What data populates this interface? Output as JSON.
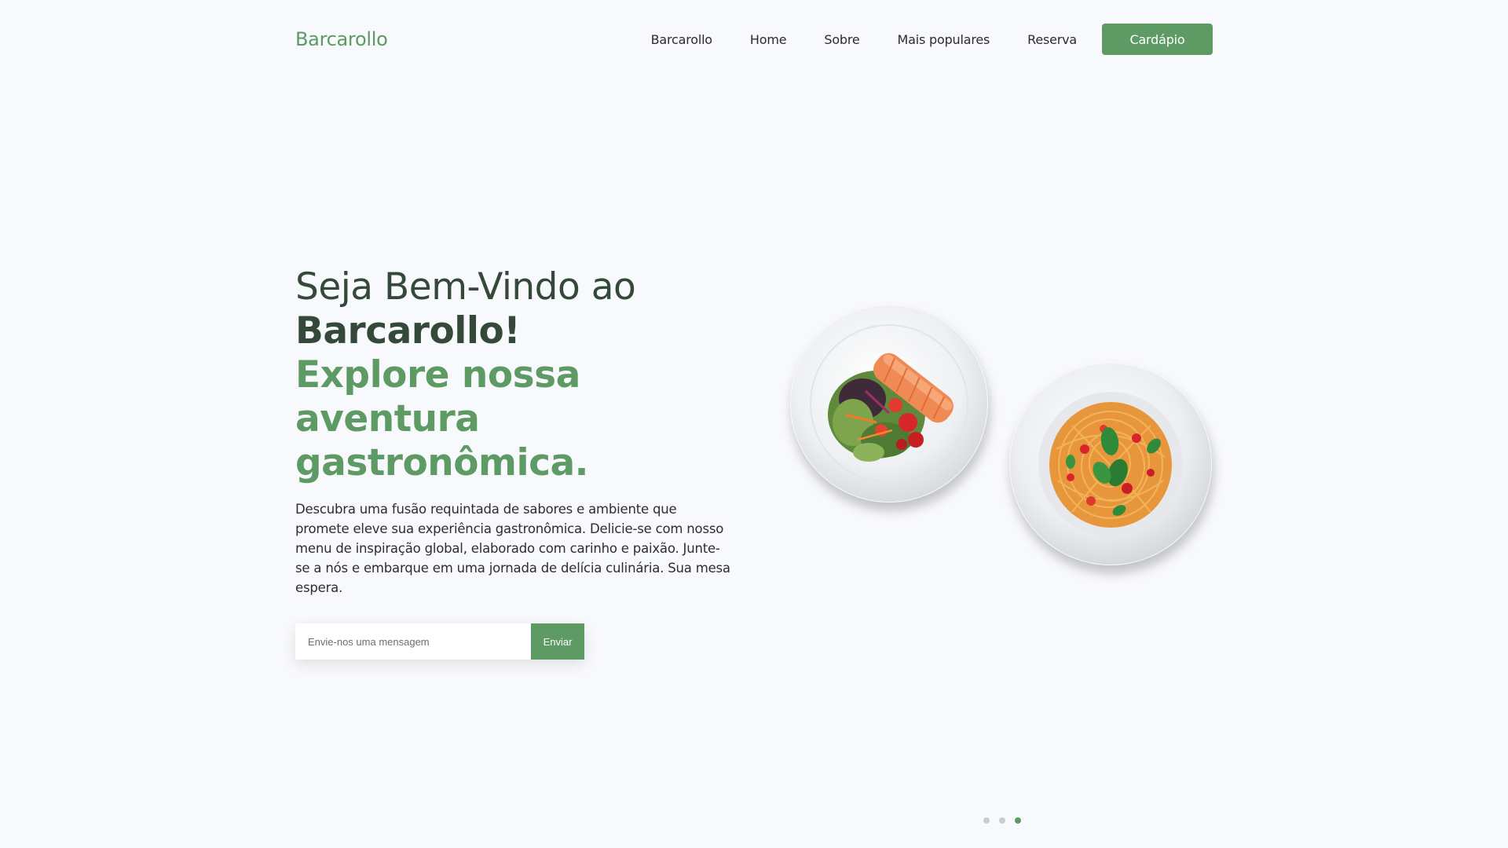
{
  "header": {
    "logo": "Barcarollo",
    "nav": [
      {
        "label": "Barcarollo"
      },
      {
        "label": "Home"
      },
      {
        "label": "Sobre"
      },
      {
        "label": "Mais populares"
      },
      {
        "label": "Reserva"
      }
    ],
    "cta_label": "Cardápio"
  },
  "hero": {
    "welcome": "Seja Bem-Vindo ao",
    "brand": "Barcarollo!",
    "tagline": "Explore nossa aventura gastronômica.",
    "description": "Descubra uma fusão requintada de sabores e ambiente que promete eleve sua experiência gastronômica. Delicie-se com nosso menu de inspiração global, elaborado com carinho e paixão. Junte-se a nós e embarque em uma jornada de delícia culinária. Sua mesa espera."
  },
  "form": {
    "placeholder": "Envie-nos uma mensagem",
    "button_label": "Enviar"
  },
  "dishes": [
    {
      "name": "salmon-salad-plate"
    },
    {
      "name": "spaghetti-plate"
    }
  ],
  "carousel": {
    "count": 3,
    "active_index": 2
  },
  "colors": {
    "accent": "#5e9a63",
    "heading_dark": "#34493a",
    "background": "#f8f9fc"
  }
}
